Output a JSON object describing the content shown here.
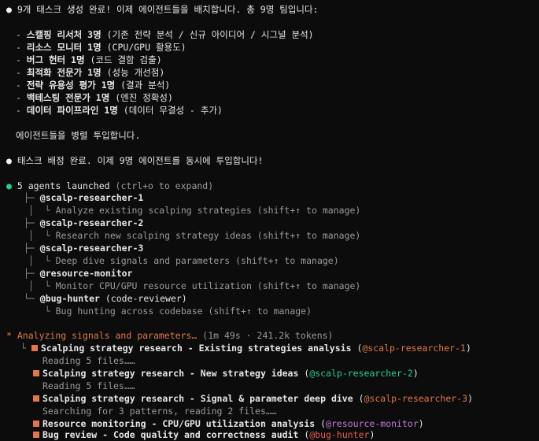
{
  "msg1": {
    "bullet": "●",
    "intro": "9개 태스크 생성 완료! 이제 에이전트들을 배치합니다. 총 9명 팀입니다:",
    "items": [
      {
        "bold": "스캘핑 리서처 3명",
        "rest": " (기존 전략 분석 / 신규 아이디어 / 시그널 분석)"
      },
      {
        "bold": "리소스 모니터 1명",
        "rest": " (CPU/GPU 활용도)"
      },
      {
        "bold": "버그 헌터 1명",
        "rest": " (코드 결함 검출)"
      },
      {
        "bold": "최적화 전문가 1명",
        "rest": " (성능 개선점)"
      },
      {
        "bold": "전략 유용성 평가 1명",
        "rest": " (결과 분석)"
      },
      {
        "bold": "백테스팅 전문가 1명",
        "rest": " (엔진 정확성)"
      },
      {
        "bold": "데이터 파이프라인 1명",
        "rest": " (데이터 무결성 - 추가)"
      }
    ],
    "outro": "에이전트들을 병렬 투입합니다."
  },
  "msg2": {
    "bullet": "●",
    "text": "태스크 배정 완료. 이제 9명 에이전트를 동시에 투입합니다!"
  },
  "agents": {
    "bullet": "●",
    "header": "5 agents launched",
    "hint": "(ctrl+o to expand)",
    "list": [
      {
        "name": "@scalp-researcher-1",
        "extra": "",
        "desc": "Analyze existing scalping strategies (shift+↑ to manage)"
      },
      {
        "name": "@scalp-researcher-2",
        "extra": "",
        "desc": "Research new scalping strategy ideas (shift+↑ to manage)"
      },
      {
        "name": "@scalp-researcher-3",
        "extra": "",
        "desc": "Deep dive signals and parameters (shift+↑ to manage)"
      },
      {
        "name": "@resource-monitor",
        "extra": "",
        "desc": "Monitor CPU/GPU resource utilization (shift+↑ to manage)"
      },
      {
        "name": "@bug-hunter",
        "extra": " (code-reviewer)",
        "desc": "Bug hunting across codebase (shift+↑ to manage)"
      }
    ]
  },
  "status": {
    "spinner": "*",
    "text": "Analyzing signals and parameters…",
    "meta": "(1m 49s · 241.2k tokens)"
  },
  "tasks": [
    {
      "title": "Scalping strategy research - Existing strategies analysis",
      "agent": "@scalp-researcher-1",
      "agent_color": "#e0784a",
      "sub": "Reading 5 files……"
    },
    {
      "title": "Scalping strategy research - New strategy ideas",
      "agent": "@scalp-researcher-2",
      "agent_color": "#23d18b",
      "sub": "Reading 5 files……"
    },
    {
      "title": "Scalping strategy research - Signal & parameter deep dive",
      "agent": "@scalp-researcher-3",
      "agent_color": "#e0784a",
      "sub": "Searching for 3 patterns, reading 2 files……"
    },
    {
      "title": "Resource monitoring - CPU/GPU utilization analysis",
      "agent": "@resource-monitor",
      "agent_color": "#c678dd",
      "sub": ""
    },
    {
      "title": "Bug review - Code quality and correctness audit",
      "agent": "@bug-hunter",
      "agent_color": "#e85a4f",
      "sub": ""
    }
  ]
}
